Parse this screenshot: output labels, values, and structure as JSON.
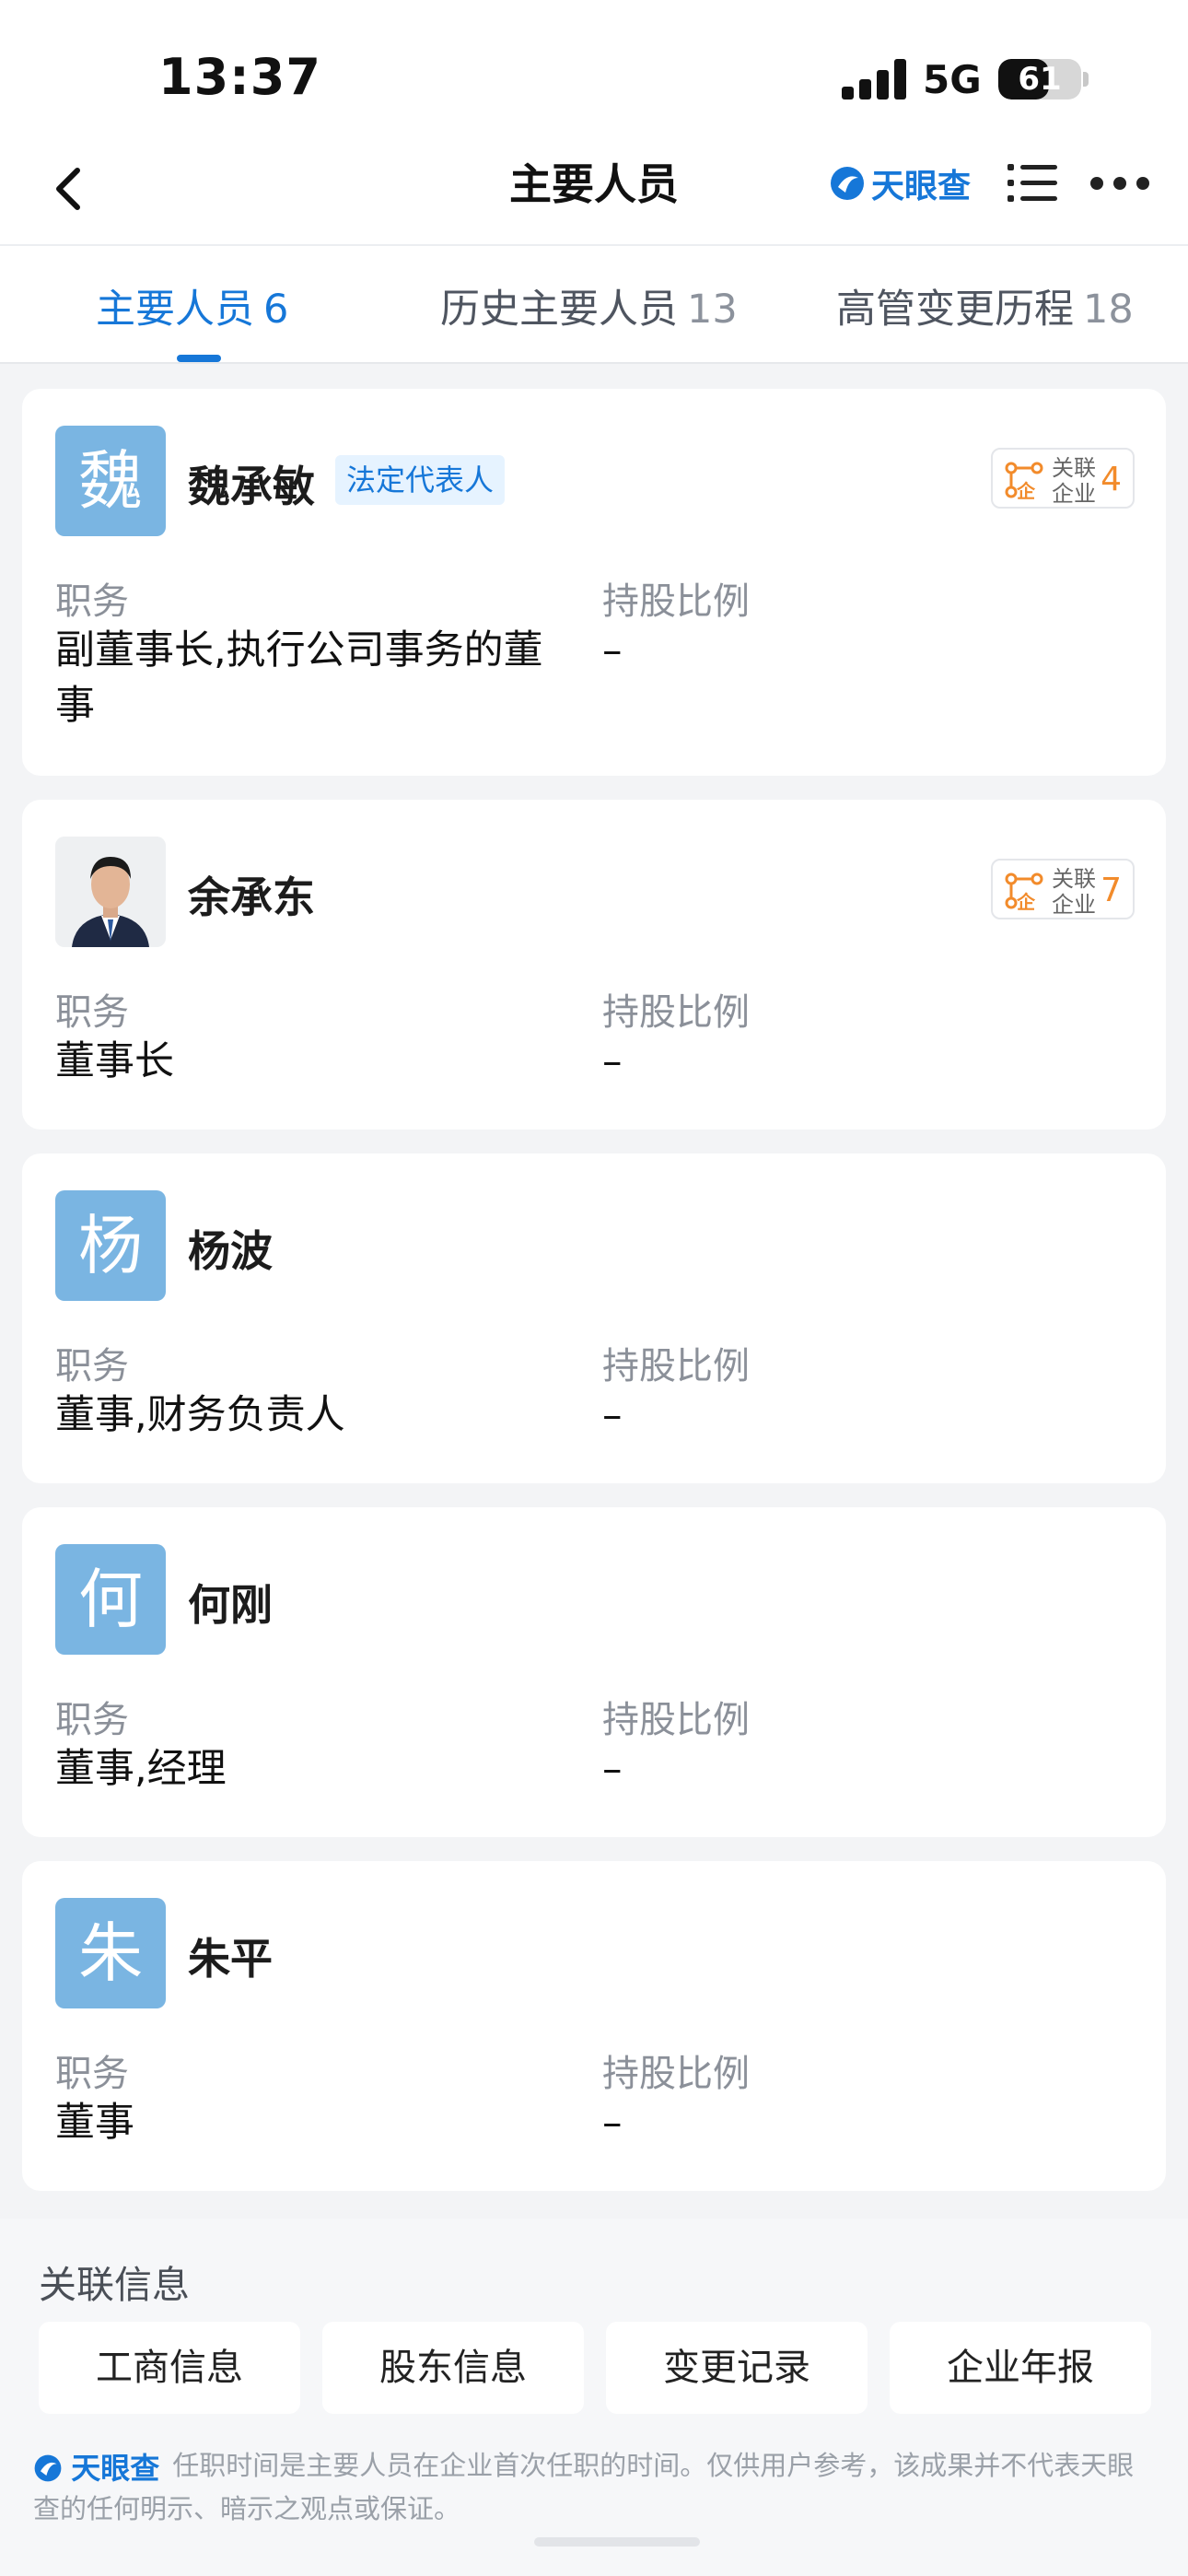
{
  "status_bar": {
    "time": "13:37",
    "network": "5G",
    "battery": "61",
    "battery_level": 0.61
  },
  "nav": {
    "title": "主要人员",
    "brand": "天眼查"
  },
  "tabs": [
    {
      "label": "主要人员",
      "count": "6",
      "active": true
    },
    {
      "label": "历史主要人员",
      "count": "13",
      "active": false
    },
    {
      "label": "高管变更历程",
      "count": "18",
      "active": false
    }
  ],
  "people": [
    {
      "avatar_char": "魏",
      "name": "魏承敏",
      "tag": "法定代表人",
      "assoc_label_1": "关联",
      "assoc_label_2": "企业",
      "assoc_count": "4",
      "position_label": "职务",
      "position": "副董事长,执行公司事务的董事",
      "share_label": "持股比例",
      "share": "–"
    },
    {
      "avatar_char": "",
      "name": "余承东",
      "assoc_label_1": "关联",
      "assoc_label_2": "企业",
      "assoc_count": "7",
      "position_label": "职务",
      "position": "董事长",
      "share_label": "持股比例",
      "share": "–"
    },
    {
      "avatar_char": "杨",
      "name": "杨波",
      "position_label": "职务",
      "position": "董事,财务负责人",
      "share_label": "持股比例",
      "share": "–"
    },
    {
      "avatar_char": "何",
      "name": "何刚",
      "position_label": "职务",
      "position": "董事,经理",
      "share_label": "持股比例",
      "share": "–"
    },
    {
      "avatar_char": "朱",
      "name": "朱平",
      "position_label": "职务",
      "position": "董事",
      "share_label": "持股比例",
      "share": "–"
    }
  ],
  "related": {
    "title": "关联信息",
    "buttons": [
      "工商信息",
      "股东信息",
      "变更记录",
      "企业年报"
    ],
    "disclaimer_brand": "天眼查",
    "disclaimer": "任职时间是主要人员在企业首次任职的时间。仅供用户参考，该成果并不代表天眼查的任何明示、暗示之观点或保证。"
  }
}
